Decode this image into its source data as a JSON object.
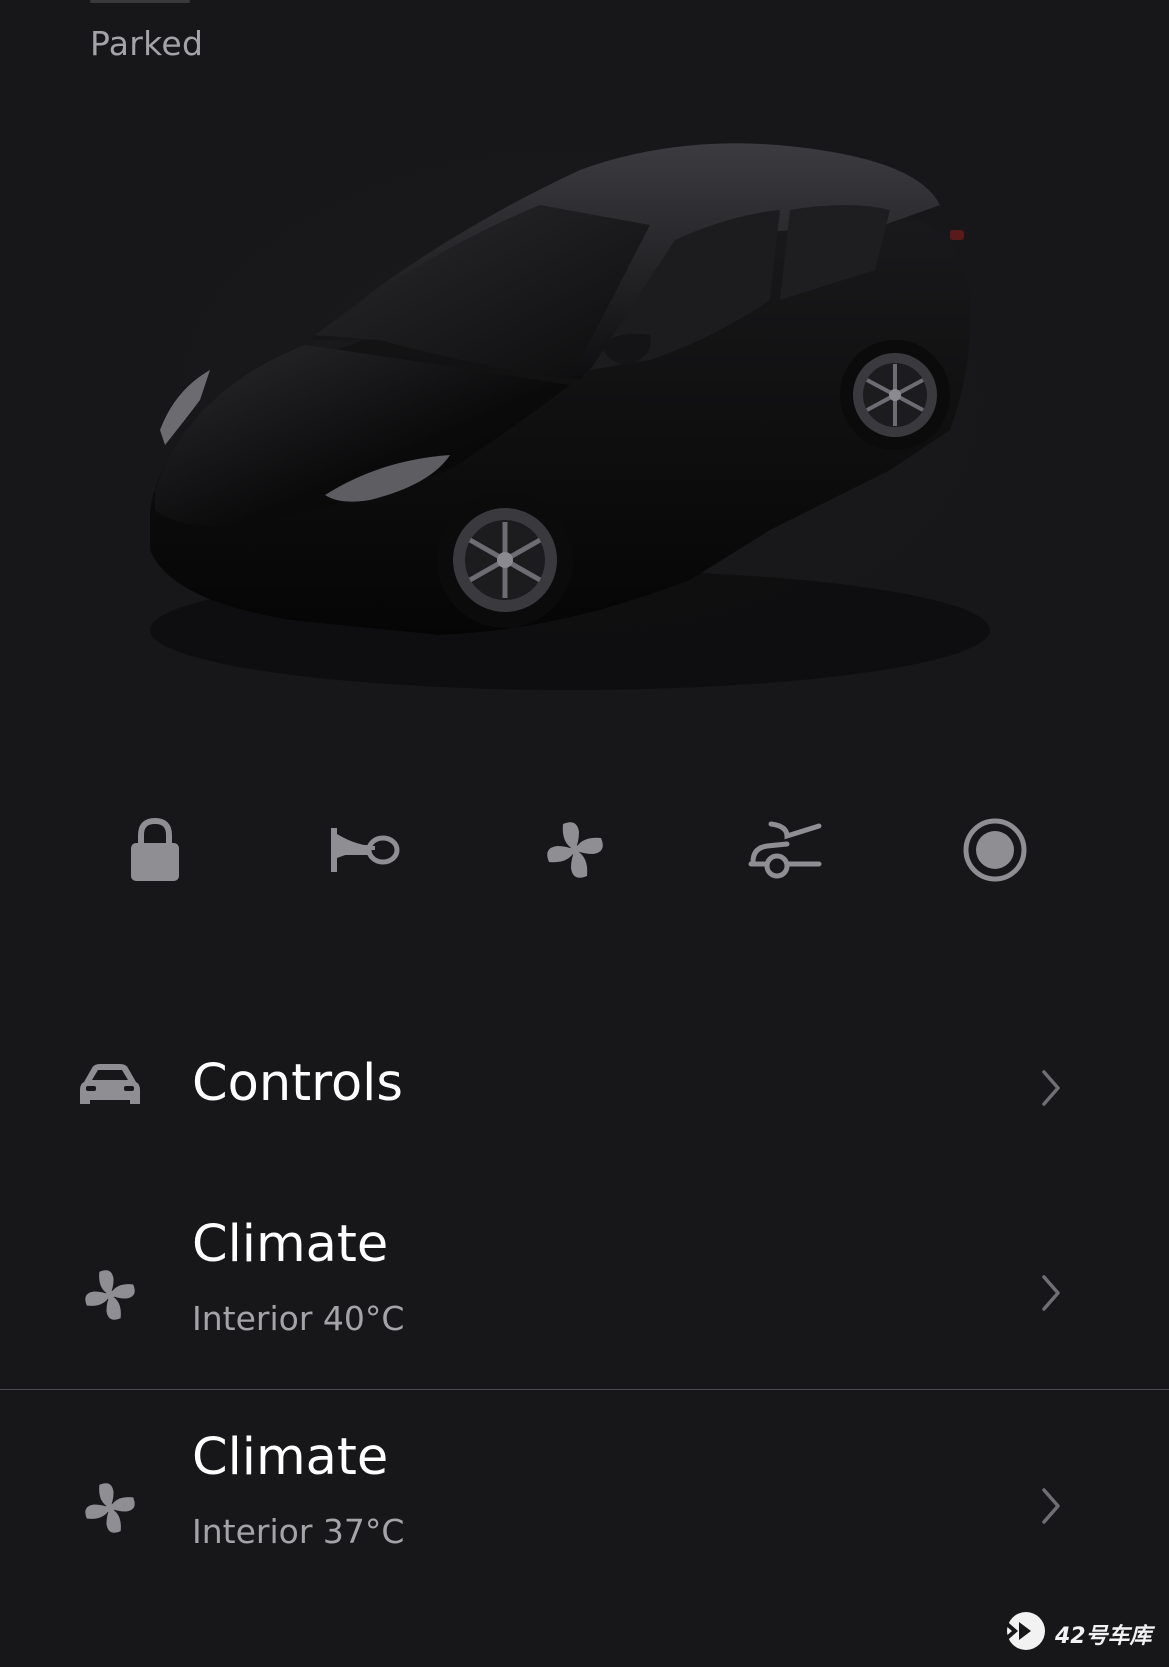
{
  "status": {
    "label": "Parked"
  },
  "vehicle": {
    "image_icon": "car-render"
  },
  "quick_actions": [
    {
      "name": "lock",
      "icon": "lock-icon"
    },
    {
      "name": "horn",
      "icon": "horn-icon"
    },
    {
      "name": "fan",
      "icon": "fan-icon"
    },
    {
      "name": "frunk",
      "icon": "frunk-icon"
    },
    {
      "name": "record",
      "icon": "record-icon"
    }
  ],
  "menu": {
    "controls": {
      "title": "Controls",
      "icon": "car-icon"
    },
    "climate_1": {
      "title": "Climate",
      "subtitle": "Interior 40°C",
      "icon": "fan-icon"
    },
    "climate_2": {
      "title": "Climate",
      "subtitle": "Interior 37°C",
      "icon": "fan-icon"
    }
  },
  "watermark": {
    "text": "42号车库"
  },
  "colors": {
    "background": "#171719",
    "icon_gray": "#8e8e93",
    "secondary_text": "#a4a4a8",
    "primary_text": "#ffffff"
  }
}
